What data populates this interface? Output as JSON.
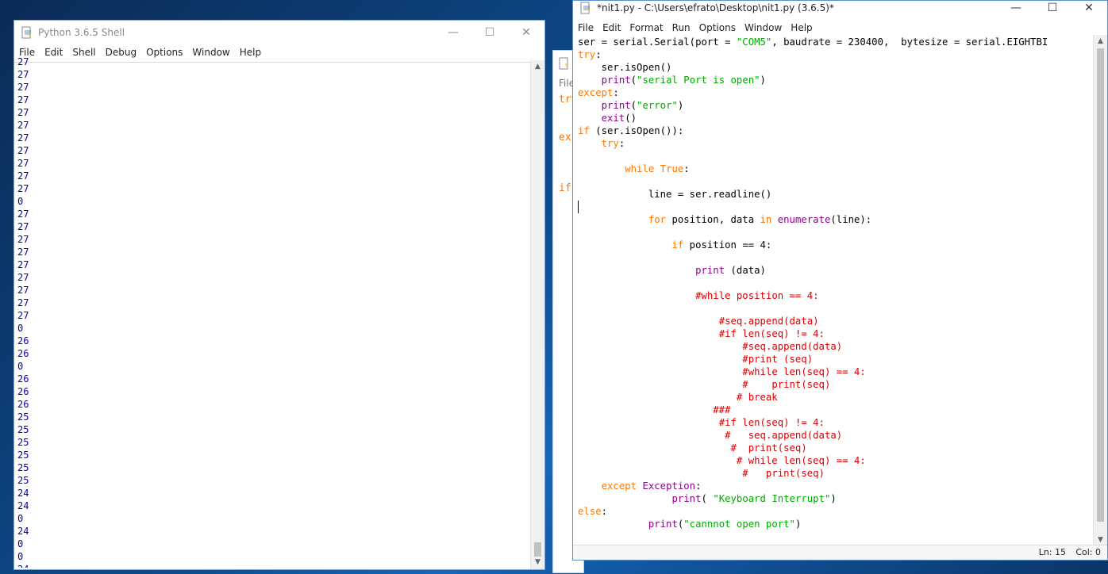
{
  "shell": {
    "title": "Python 3.6.5 Shell",
    "menu": [
      "File",
      "Edit",
      "Shell",
      "Debug",
      "Options",
      "Window",
      "Help"
    ],
    "output": [
      "27",
      "27",
      "27",
      "27",
      "27",
      "27",
      "27",
      "27",
      "27",
      "27",
      "27",
      "0",
      "27",
      "27",
      "27",
      "27",
      "27",
      "27",
      "27",
      "27",
      "27",
      "0",
      "26",
      "26",
      "0",
      "26",
      "26",
      "26",
      "25",
      "25",
      "25",
      "25",
      "25",
      "25",
      "24",
      "24",
      "0",
      "24",
      "0",
      "0",
      "24"
    ]
  },
  "mid_window": {
    "menu_partial": "File",
    "code_partial": [
      "try",
      "exc",
      "if"
    ]
  },
  "editor": {
    "title": "*nit1.py - C:\\Users\\efrato\\Desktop\\nit1.py (3.6.5)*",
    "menu": [
      "File",
      "Edit",
      "Format",
      "Run",
      "Options",
      "Window",
      "Help"
    ],
    "status": {
      "line": "Ln: 15",
      "col": "Col: 0"
    },
    "code": [
      [
        [
          "t",
          "ser = serial.Serial(port = "
        ],
        [
          "st",
          "\"COM5\""
        ],
        [
          "t",
          ", baudrate = 230400,  bytesize = serial.EIGHTBI"
        ]
      ],
      [
        [
          "kw",
          "try"
        ],
        [
          "t",
          ":"
        ]
      ],
      [
        [
          "t",
          "    ser.isOpen()"
        ]
      ],
      [
        [
          "t",
          "    "
        ],
        [
          "bi",
          "print"
        ],
        [
          "t",
          "("
        ],
        [
          "st",
          "\"serial Port is open\""
        ],
        [
          "t",
          ")"
        ]
      ],
      [
        [
          "kw",
          "except"
        ],
        [
          "t",
          ":"
        ]
      ],
      [
        [
          "t",
          "    "
        ],
        [
          "bi",
          "print"
        ],
        [
          "t",
          "("
        ],
        [
          "st",
          "\"error\""
        ],
        [
          "t",
          ")"
        ]
      ],
      [
        [
          "t",
          "    "
        ],
        [
          "bi",
          "exit"
        ],
        [
          "t",
          "()"
        ]
      ],
      [
        [
          "kw",
          "if"
        ],
        [
          "t",
          " (ser.isOpen()):"
        ]
      ],
      [
        [
          "t",
          "    "
        ],
        [
          "kw",
          "try"
        ],
        [
          "t",
          ":"
        ]
      ],
      [
        [
          "t",
          ""
        ]
      ],
      [
        [
          "t",
          "        "
        ],
        [
          "kw",
          "while"
        ],
        [
          "t",
          " "
        ],
        [
          "kw",
          "True"
        ],
        [
          "t",
          ":"
        ]
      ],
      [
        [
          "t",
          ""
        ]
      ],
      [
        [
          "t",
          "            line = ser.readline()"
        ]
      ],
      [
        [
          "t",
          ""
        ]
      ],
      [
        [
          "t",
          "            "
        ],
        [
          "kw",
          "for"
        ],
        [
          "t",
          " position, data "
        ],
        [
          "kw",
          "in"
        ],
        [
          "t",
          " "
        ],
        [
          "bi",
          "enumerate"
        ],
        [
          "t",
          "(line):"
        ]
      ],
      [
        [
          "t",
          ""
        ]
      ],
      [
        [
          "t",
          "                "
        ],
        [
          "kw",
          "if"
        ],
        [
          "t",
          " position == 4:"
        ]
      ],
      [
        [
          "t",
          ""
        ]
      ],
      [
        [
          "t",
          "                    "
        ],
        [
          "bi",
          "print"
        ],
        [
          "t",
          " (data)"
        ]
      ],
      [
        [
          "t",
          ""
        ]
      ],
      [
        [
          "t",
          "                    "
        ],
        [
          "cm",
          "#while position == 4:"
        ]
      ],
      [
        [
          "t",
          ""
        ]
      ],
      [
        [
          "t",
          "                        "
        ],
        [
          "cm",
          "#seq.append(data)"
        ]
      ],
      [
        [
          "t",
          "                        "
        ],
        [
          "cm",
          "#if len(seq) != 4:"
        ]
      ],
      [
        [
          "t",
          "                            "
        ],
        [
          "cm",
          "#seq.append(data)"
        ]
      ],
      [
        [
          "t",
          "                            "
        ],
        [
          "cm",
          "#print (seq)"
        ]
      ],
      [
        [
          "t",
          "                            "
        ],
        [
          "cm",
          "#while len(seq) == 4:"
        ]
      ],
      [
        [
          "t",
          "                            "
        ],
        [
          "cm",
          "#    print(seq)"
        ]
      ],
      [
        [
          "t",
          "                           "
        ],
        [
          "cm",
          "# break"
        ]
      ],
      [
        [
          "t",
          "                       "
        ],
        [
          "cm",
          "###"
        ]
      ],
      [
        [
          "t",
          "                        "
        ],
        [
          "cm",
          "#if len(seq) != 4:"
        ]
      ],
      [
        [
          "t",
          "                         "
        ],
        [
          "cm",
          "#   seq.append(data)"
        ]
      ],
      [
        [
          "t",
          "                          "
        ],
        [
          "cm",
          "#  print(seq)"
        ]
      ],
      [
        [
          "t",
          "                           "
        ],
        [
          "cm",
          "# while len(seq) == 4:"
        ]
      ],
      [
        [
          "t",
          "                            "
        ],
        [
          "cm",
          "#   print(seq)"
        ]
      ],
      [
        [
          "t",
          "    "
        ],
        [
          "kw",
          "except"
        ],
        [
          "t",
          " "
        ],
        [
          "bi",
          "Exception"
        ],
        [
          "t",
          ":"
        ]
      ],
      [
        [
          "t",
          "                "
        ],
        [
          "bi",
          "print"
        ],
        [
          "t",
          "( "
        ],
        [
          "st",
          "\"Keyboard Interrupt\""
        ],
        [
          "t",
          ")"
        ]
      ],
      [
        [
          "kw",
          "else"
        ],
        [
          "t",
          ":"
        ]
      ],
      [
        [
          "t",
          "            "
        ],
        [
          "bi",
          "print"
        ],
        [
          "t",
          "("
        ],
        [
          "st",
          "\"cannnot open port\""
        ],
        [
          "t",
          ")"
        ]
      ]
    ]
  },
  "window_controls": {
    "minimize": "—",
    "maximize": "☐",
    "close": "✕"
  },
  "icons": {
    "window_icon": "python-file-icon"
  }
}
